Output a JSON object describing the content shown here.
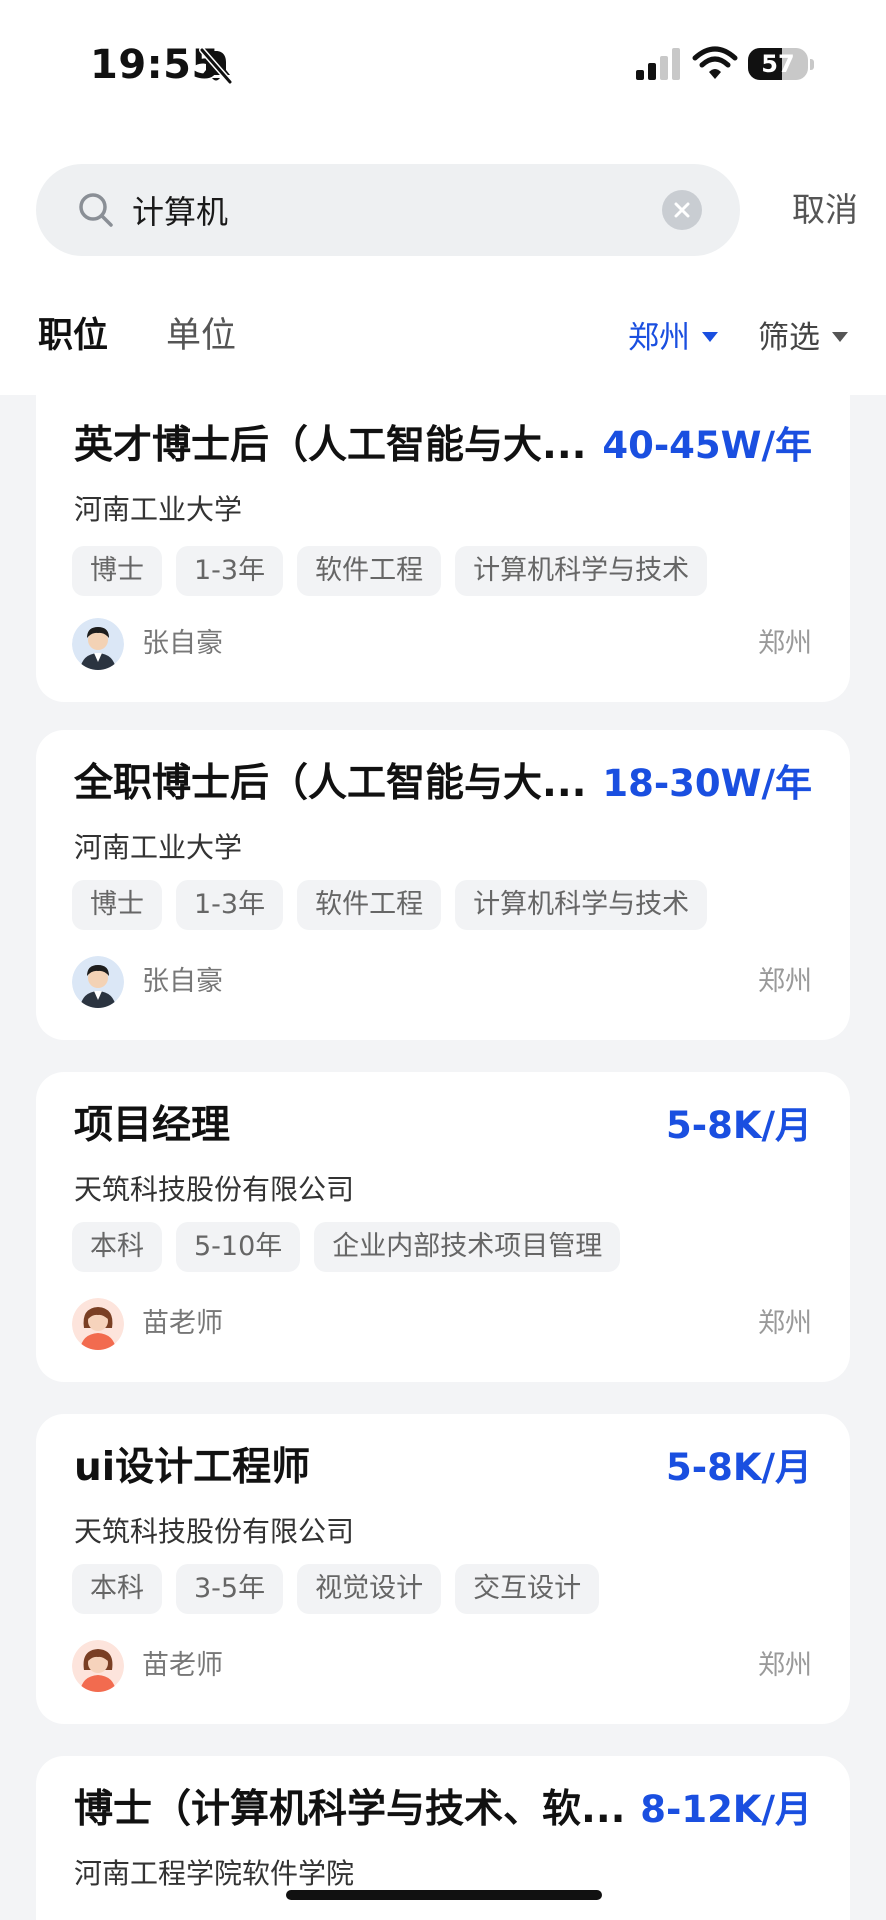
{
  "status_bar": {
    "time": "19:55",
    "battery_level": "57",
    "battery_fraction": 0.57,
    "icons": [
      "bell-slash-icon",
      "signal-icon",
      "wifi-icon",
      "battery-icon"
    ]
  },
  "search": {
    "value": "计算机",
    "placeholder": "",
    "cancel_label": "取消"
  },
  "tabs": [
    {
      "label": "职位",
      "active": true
    },
    {
      "label": "单位",
      "active": false
    }
  ],
  "filters": {
    "city": "郑州",
    "filter_label": "筛选"
  },
  "colors": {
    "accent": "#1a4fe0",
    "background": "#f3f4f6",
    "card": "#ffffff",
    "tag_bg": "#f2f3f5"
  },
  "jobs": [
    {
      "title": "英才博士后（人工智能与大...",
      "salary": "40-45W/年",
      "company": "河南工业大学",
      "tags": [
        "博士",
        "1-3年",
        "软件工程",
        "计算机科学与技术"
      ],
      "recruiter": "张自豪",
      "avatar": "male-avatar",
      "location": "郑州"
    },
    {
      "title": "全职博士后（人工智能与大...",
      "salary": "18-30W/年",
      "company": "河南工业大学",
      "tags": [
        "博士",
        "1-3年",
        "软件工程",
        "计算机科学与技术"
      ],
      "recruiter": "张自豪",
      "avatar": "male-avatar",
      "location": "郑州"
    },
    {
      "title": "项目经理",
      "salary": "5-8K/月",
      "company": "天筑科技股份有限公司",
      "tags": [
        "本科",
        "5-10年",
        "企业内部技术项目管理"
      ],
      "recruiter": "苗老师",
      "avatar": "female-avatar",
      "location": "郑州"
    },
    {
      "title": "ui设计工程师",
      "salary": "5-8K/月",
      "company": "天筑科技股份有限公司",
      "tags": [
        "本科",
        "3-5年",
        "视觉设计",
        "交互设计"
      ],
      "recruiter": "苗老师",
      "avatar": "female-avatar",
      "location": "郑州"
    },
    {
      "title": "博士（计算机科学与技术、软...",
      "salary": "8-12K/月",
      "company": "河南工程学院软件学院",
      "tags": [],
      "recruiter": "",
      "avatar": "",
      "location": ""
    }
  ]
}
